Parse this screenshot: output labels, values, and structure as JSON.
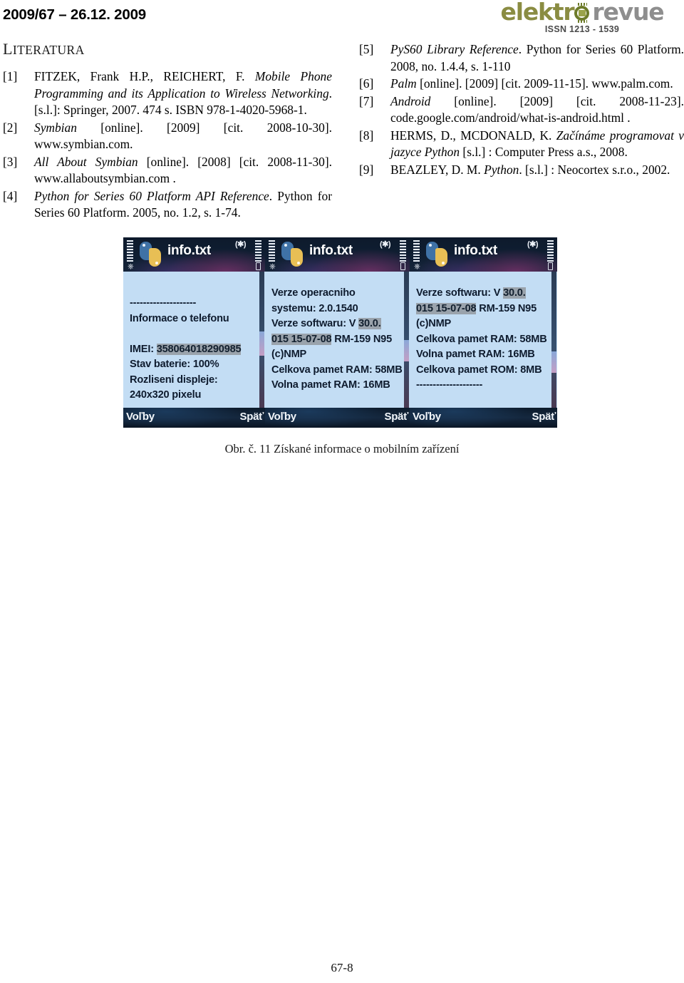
{
  "header": {
    "issue_line": "2009/67 – 26.12. 2009",
    "logo": {
      "word_part1": "elektr",
      "word_part2": "revue",
      "issn": "ISSN 1213 - 1539",
      "color_elektro": "#8a8c42",
      "color_revue": "#8e8e8e"
    }
  },
  "section": {
    "heading_first_letter": "L",
    "heading_rest": "ITERATURA"
  },
  "references": {
    "left": [
      {
        "num": "[1]",
        "parts": [
          {
            "text": "FITZEK, Frank H.P., REICHERT, F. ",
            "italic": false
          },
          {
            "text": "Mobile Phone Programming and its Application to Wireless Networking",
            "italic": true
          },
          {
            "text": ". [s.l.]: Springer, 2007. 474 s. ISBN 978-1-4020-5968-1.",
            "italic": false
          }
        ]
      },
      {
        "num": "[2]",
        "parts": [
          {
            "text": "Symbian",
            "italic": true
          },
          {
            "text": " [online]. [2009] [cit. 2008-10-30]. www.symbian.com.",
            "italic": false
          }
        ]
      },
      {
        "num": "[3]",
        "parts": [
          {
            "text": "All About Symbian",
            "italic": true
          },
          {
            "text": " [online]. [2008] [cit. 2008-11-30]. www.allaboutsymbian.com .",
            "italic": false
          }
        ]
      },
      {
        "num": "[4]",
        "parts": [
          {
            "text": "Python for Series 60 Platform API Reference",
            "italic": true
          },
          {
            "text": ". Python for Series 60 Platform. 2005, no. 1.2, s. 1-74.",
            "italic": false
          }
        ]
      }
    ],
    "right": [
      {
        "num": "[5]",
        "parts": [
          {
            "text": "PyS60 Library Reference",
            "italic": true
          },
          {
            "text": ". Python for Series 60 Platform. 2008, no. 1.4.4, s. 1-110",
            "italic": false
          }
        ]
      },
      {
        "num": "[6]",
        "parts": [
          {
            "text": "Palm",
            "italic": true
          },
          {
            "text": " [online]. [2009] [cit. 2009-11-15]. www.palm.com.",
            "italic": false
          }
        ]
      },
      {
        "num": "[7]",
        "parts": [
          {
            "text": "Android",
            "italic": true
          },
          {
            "text": " [online]. [2009] [cit. 2008-11-23]. code.google.com/android/what-is-android.html .",
            "italic": false
          }
        ]
      },
      {
        "num": "[8]",
        "parts": [
          {
            "text": "HERMS, D., MCDONALD, K. ",
            "italic": false
          },
          {
            "text": "Začínáme programovat v jazyce Python",
            "italic": true
          },
          {
            "text": " [s.l.] : Computer Press a.s., 2008.",
            "italic": false
          }
        ]
      },
      {
        "num": "[9]",
        "parts": [
          {
            "text": "BEAZLEY, D. M. ",
            "italic": false
          },
          {
            "text": "Python",
            "italic": true
          },
          {
            "text": ". [s.l.] : Neocortex s.r.o., 2002.",
            "italic": false
          }
        ]
      }
    ]
  },
  "figure": {
    "caption": "Obr. č. 11 Získané informace o mobilním zařízení",
    "screens": [
      {
        "title": "info.txt",
        "bluetooth_indicator": "(✱)",
        "softkey_left": "Voľby",
        "softkey_right": "Späť",
        "lines": [
          {
            "text": "--------------------",
            "highlight": false
          },
          {
            "text": "Informace o telefonu",
            "highlight": false
          },
          {
            "text": "",
            "highlight": false
          },
          {
            "text": "IMEI: ",
            "highlight": false,
            "tail": "358064018290985",
            "tail_highlight": true
          },
          {
            "text": "Stav baterie: 100%",
            "highlight": false
          },
          {
            "text": "Rozliseni displeje:",
            "highlight": false
          },
          {
            "text": "240x320 pixelu",
            "highlight": false
          }
        ]
      },
      {
        "title": "info.txt",
        "bluetooth_indicator": "(✱)",
        "softkey_left": "Voľby",
        "softkey_right": "Späť",
        "lines": [
          {
            "text": "Verze operacniho",
            "highlight": false
          },
          {
            "text": "systemu: 2.0.1540",
            "highlight": false
          },
          {
            "text": "Verze softwaru: V ",
            "highlight": false,
            "tail": "30.0.",
            "tail_highlight": true
          },
          {
            "text": "015 15-07-08",
            "highlight": true,
            "tail": " RM-159 N95",
            "tail_highlight": false
          },
          {
            "text": "(c)NMP",
            "highlight": false
          },
          {
            "text": "Celkova pamet RAM: 58MB",
            "highlight": false
          },
          {
            "text": "Volna pamet RAM: 16MB",
            "highlight": false
          }
        ]
      },
      {
        "title": "info.txt",
        "bluetooth_indicator": "(✱)",
        "softkey_left": "Voľby",
        "softkey_right": "Späť",
        "lines": [
          {
            "text": "Verze softwaru: V ",
            "highlight": false,
            "tail": "30.0.",
            "tail_highlight": true
          },
          {
            "text": "015 15-07-08",
            "highlight": true,
            "tail": " RM-159 N95",
            "tail_highlight": false
          },
          {
            "text": "(c)NMP",
            "highlight": false
          },
          {
            "text": "Celkova pamet RAM: 58MB",
            "highlight": false
          },
          {
            "text": "Volna pamet RAM: 16MB",
            "highlight": false
          },
          {
            "text": "Celkova pamet ROM: 8MB",
            "highlight": false
          },
          {
            "text": "--------------------",
            "highlight": false
          }
        ]
      }
    ]
  },
  "footer": {
    "page_number": "67-8"
  }
}
